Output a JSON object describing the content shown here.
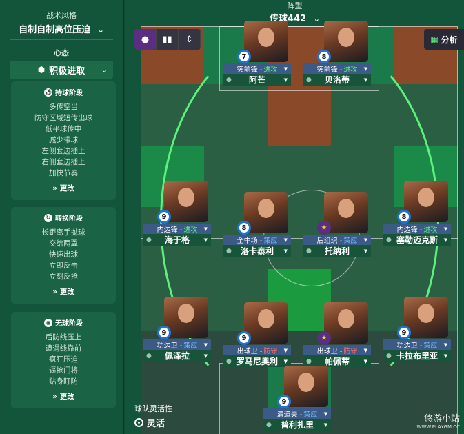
{
  "sidebar": {
    "tactic_style_label": "战术风格",
    "tactic_style_value": "自制自制高位压迫",
    "mentality_label": "心态",
    "mentality_value": "积极进取",
    "panels": [
      {
        "title": "持球阶段",
        "icon": "ball-icon",
        "items": [
          "多传空当",
          "防守区域短传出球",
          "低平球传中",
          "减少带球",
          "左侧套边插上",
          "右侧套边插上",
          "加快节奏"
        ],
        "change": "更改"
      },
      {
        "title": "转换阶段",
        "icon": "transition-icon",
        "items": [
          "长距离手抛球",
          "交给两翼",
          "快速出球",
          "立即反击",
          "立刻反抢"
        ],
        "change": "更改"
      },
      {
        "title": "无球阶段",
        "icon": "defense-icon",
        "items": [
          "后防线压上",
          "遭遇线靠前",
          "疯狂压迫",
          "逼抢门将",
          "贴身盯防"
        ],
        "change": "更改"
      }
    ]
  },
  "pitch": {
    "formation_label": "阵型",
    "formation_value": "传球442",
    "analysis_label": "分析",
    "flexibility_label": "球队灵活性",
    "flexibility_value": "灵活",
    "watermark": "悠游小站",
    "watermark_url": "WWW.PLAYGM.CC"
  },
  "players": [
    {
      "id": "st-left",
      "badge": "7",
      "role": "突前锋 -",
      "duty": "进攻",
      "name": "阿芒"
    },
    {
      "id": "st-right",
      "badge": "8",
      "role": "突前锋 -",
      "duty": "进攻",
      "name": "贝洛蒂"
    },
    {
      "id": "ml",
      "badge": "9",
      "role": "内边锋 -",
      "duty": "进攻",
      "name": "海于格"
    },
    {
      "id": "mcl",
      "badge": "8",
      "role": "全中场 -",
      "duty": "策应",
      "name": "洛卡泰利"
    },
    {
      "id": "mcr",
      "badge": "★",
      "role": "后组织 -",
      "duty": "策应",
      "name": "托纳利"
    },
    {
      "id": "mr",
      "badge": "8",
      "role": "内边锋 -",
      "duty": "进攻",
      "name": "塞勒迈克斯"
    },
    {
      "id": "dl",
      "badge": "9",
      "role": "功边卫 -",
      "duty": "策应",
      "name": "佩泽拉"
    },
    {
      "id": "dcl",
      "badge": "9",
      "role": "出球卫 -",
      "duty": "防守",
      "name": "罗马尼奥利"
    },
    {
      "id": "dcr",
      "badge": "★",
      "role": "出球卫 -",
      "duty": "防守",
      "name": "帕佩蒂"
    },
    {
      "id": "dr",
      "badge": "9",
      "role": "功边卫 -",
      "duty": "策应",
      "name": "卡拉布里亚"
    },
    {
      "id": "gk",
      "badge": "9",
      "role": "清道夫 -",
      "duty": "策应",
      "name": "普利扎里"
    }
  ],
  "colors": {
    "attack": "#5ef07d",
    "support": "#6fb8ff",
    "defend": "#ff6b6b",
    "tactic_purple": "#5a2e80"
  }
}
